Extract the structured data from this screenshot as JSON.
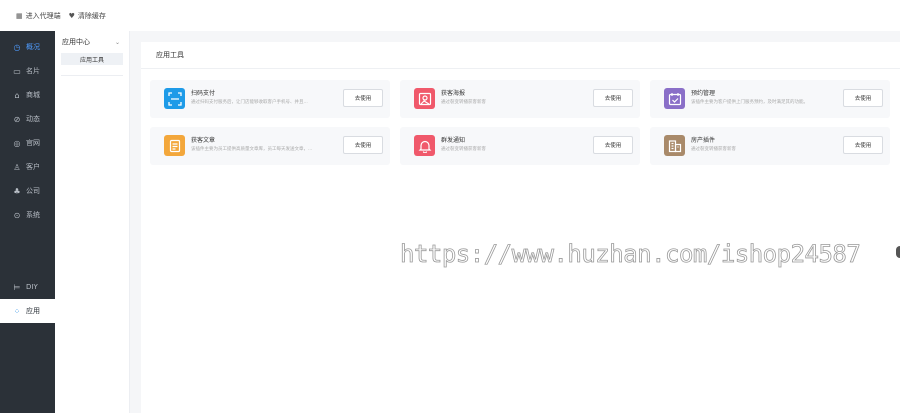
{
  "topbar": {
    "proxy_label": "进入代理端",
    "clear_label": "清除缓存"
  },
  "sidebar": {
    "items": [
      {
        "label": "概况",
        "icon": "dashboard-icon"
      },
      {
        "label": "名片",
        "icon": "card-icon"
      },
      {
        "label": "商城",
        "icon": "shop-icon"
      },
      {
        "label": "动态",
        "icon": "compass-icon"
      },
      {
        "label": "官网",
        "icon": "globe-icon"
      },
      {
        "label": "客户",
        "icon": "user-icon"
      },
      {
        "label": "公司",
        "icon": "org-icon"
      },
      {
        "label": "系统",
        "icon": "settings-icon"
      },
      {
        "label": "DIY",
        "icon": "diy-icon"
      },
      {
        "label": "应用",
        "icon": "apps-icon"
      }
    ]
  },
  "subnav": {
    "group_label": "应用中心",
    "selected_label": "应用工具"
  },
  "content": {
    "title": "应用工具",
    "apps": [
      {
        "name": "扫码支付",
        "desc": "通过扫码支付服务后，让门店能够收取客户手机号、并且...",
        "button": "去使用",
        "color": "#1e9be8",
        "icon": "scan-icon"
      },
      {
        "name": "获客海报",
        "desc": "通过裂变转播获客新客",
        "button": "去使用",
        "color": "#f0596b",
        "icon": "poster-icon"
      },
      {
        "name": "预约管理",
        "desc": "该插件主要为客户提供上门服务预约，及时满足其的功能。",
        "button": "去使用",
        "color": "#8a6fc8",
        "icon": "calendar-icon"
      },
      {
        "name": "获客文章",
        "desc": "该插件主要为员工提供高质量文章库，员工每天发送文章，...",
        "button": "去使用",
        "color": "#f3a73b",
        "icon": "article-icon"
      },
      {
        "name": "群发通知",
        "desc": "通过裂变转播获客新客",
        "button": "去使用",
        "color": "#f0596b",
        "icon": "bell-icon"
      },
      {
        "name": "房产插件",
        "desc": "通过裂变转播获客新客",
        "button": "去使用",
        "color": "#a98a6a",
        "icon": "house-icon"
      }
    ]
  },
  "watermark": "https://www.huzhan.com/ishop24587"
}
